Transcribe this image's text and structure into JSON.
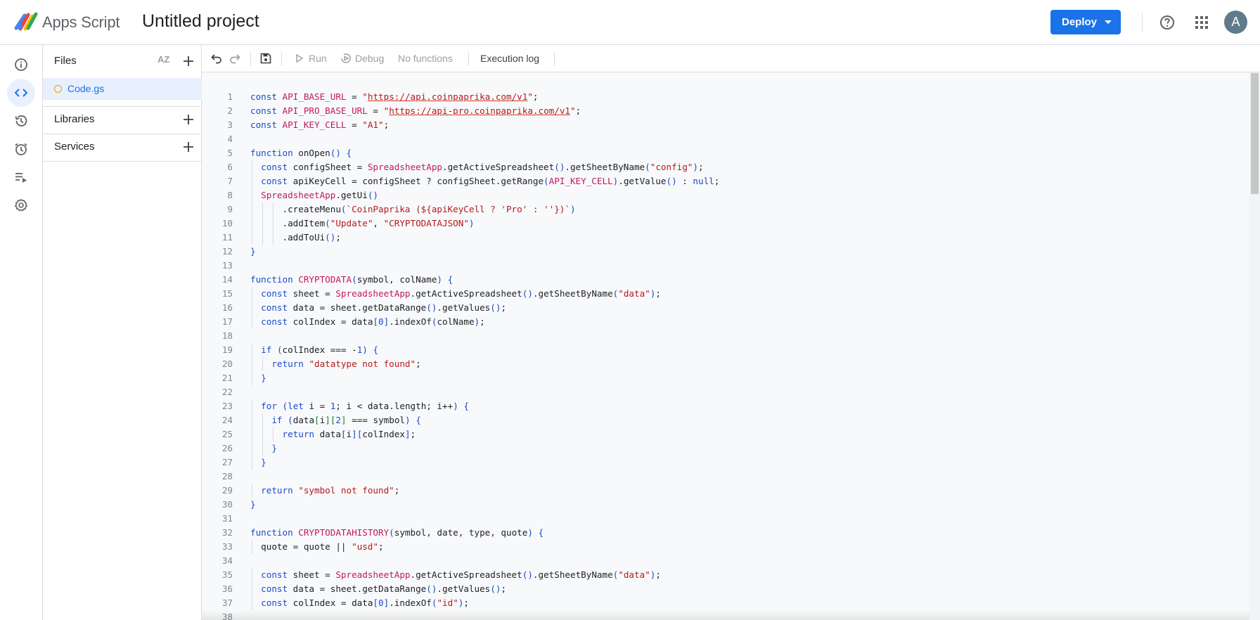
{
  "header": {
    "app_name": "Apps Script",
    "project_title": "Untitled project",
    "deploy_label": "Deploy",
    "avatar_letter": "A",
    "brand_color": "#1a73e8"
  },
  "rail": {
    "items": [
      "overview-icon",
      "editor-icon",
      "executions-icon",
      "triggers-icon",
      "executions-log-icon",
      "settings-icon"
    ],
    "active": "editor-icon"
  },
  "files_panel": {
    "files_title": "Files",
    "sort_label": "AZ",
    "files": [
      {
        "name": "Code.gs"
      }
    ],
    "libraries_title": "Libraries",
    "services_title": "Services"
  },
  "toolbar": {
    "run_label": "Run",
    "debug_label": "Debug",
    "function_select": "No functions",
    "execution_log_label": "Execution log"
  },
  "code": {
    "lines": [
      "const API_BASE_URL = \"https://api.coinpaprika.com/v1\";",
      "const API_PRO_BASE_URL = \"https://api-pro.coinpaprika.com/v1\";",
      "const API_KEY_CELL = \"A1\";",
      "",
      "function onOpen() {",
      "  const configSheet = SpreadsheetApp.getActiveSpreadsheet().getSheetByName(\"config\");",
      "  const apiKeyCell = configSheet ? configSheet.getRange(API_KEY_CELL).getValue() : null;",
      "  SpreadsheetApp.getUi()",
      "      .createMenu(`CoinPaprika (${apiKeyCell ? 'Pro' : ''})`)",
      "      .addItem(\"Update\", \"CRYPTODATAJSON\")",
      "      .addToUi();",
      "}",
      "",
      "function CRYPTODATA(symbol, colName) {",
      "  const sheet = SpreadsheetApp.getActiveSpreadsheet().getSheetByName(\"data\");",
      "  const data = sheet.getDataRange().getValues();",
      "  const colIndex = data[0].indexOf(colName);",
      "",
      "  if (colIndex === -1) {",
      "    return \"datatype not found\";",
      "  }",
      "",
      "  for (let i = 1; i < data.length; i++) {",
      "    if (data[i][2] === symbol) {",
      "      return data[i][colIndex];",
      "    }",
      "  }",
      "",
      "  return \"symbol not found\";",
      "}",
      "",
      "function CRYPTODATAHISTORY(symbol, date, type, quote) {",
      "  quote = quote || \"usd\";",
      "",
      "  const sheet = SpreadsheetApp.getActiveSpreadsheet().getSheetByName(\"data\");",
      "  const data = sheet.getDataRange().getValues();",
      "  const colIndex = data[0].indexOf(\"id\");",
      ""
    ]
  }
}
